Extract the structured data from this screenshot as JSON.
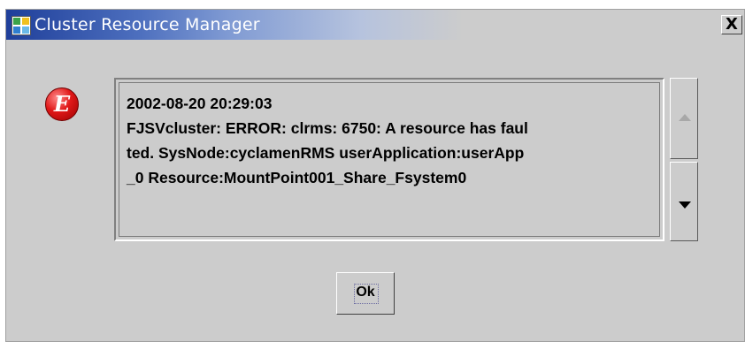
{
  "window": {
    "title": "Cluster Resource Manager",
    "close_label": "X",
    "app_icon": "cluster-app-icon"
  },
  "dialog": {
    "icon": "error-icon",
    "icon_glyph": "E",
    "message": "2002-08-20 20:29:03\nFJSVcluster: ERROR: clrms: 6750: A resource has faul\nted. SysNode:cyclamenRMS userApplication:userApp\n_0 Resource:MountPoint001_Share_Fsystem0",
    "ok_label": "Ok"
  },
  "colors": {
    "title_gradient_start": "#1f3f9a",
    "dialog_bg": "#cccccc",
    "error_red": "#e01818"
  }
}
